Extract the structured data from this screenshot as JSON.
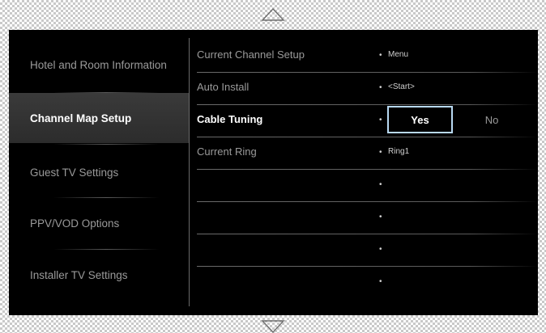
{
  "icons": {
    "scroll_up": "triangle-up-outline",
    "scroll_down": "triangle-down-outline"
  },
  "colors": {
    "background": "#000000",
    "highlight_border": "#b8d9f2",
    "dim_text": "#9a9a9a",
    "active_text": "#ffffff"
  },
  "left_menu": {
    "items": [
      {
        "label": "Hotel and Room Information",
        "selected": false
      },
      {
        "label": "Channel Map Setup",
        "selected": true
      },
      {
        "label": "Guest TV Settings",
        "selected": false
      },
      {
        "label": "PPV/VOD Options",
        "selected": false
      },
      {
        "label": "Installer TV Settings",
        "selected": false
      }
    ]
  },
  "settings": {
    "rows": [
      {
        "label": "Current Channel Setup",
        "value": "Menu"
      },
      {
        "label": "Auto Install",
        "value": "<Start>"
      },
      {
        "label": "Cable Tuning",
        "value": ""
      },
      {
        "label": "Current Ring",
        "value": "Ring1"
      },
      {
        "label": "",
        "value": ""
      },
      {
        "label": "",
        "value": ""
      },
      {
        "label": "",
        "value": ""
      },
      {
        "label": "",
        "value": ""
      }
    ],
    "cable_tuning_options": {
      "yes_label": "Yes",
      "no_label": "No",
      "focused": "Yes"
    }
  }
}
